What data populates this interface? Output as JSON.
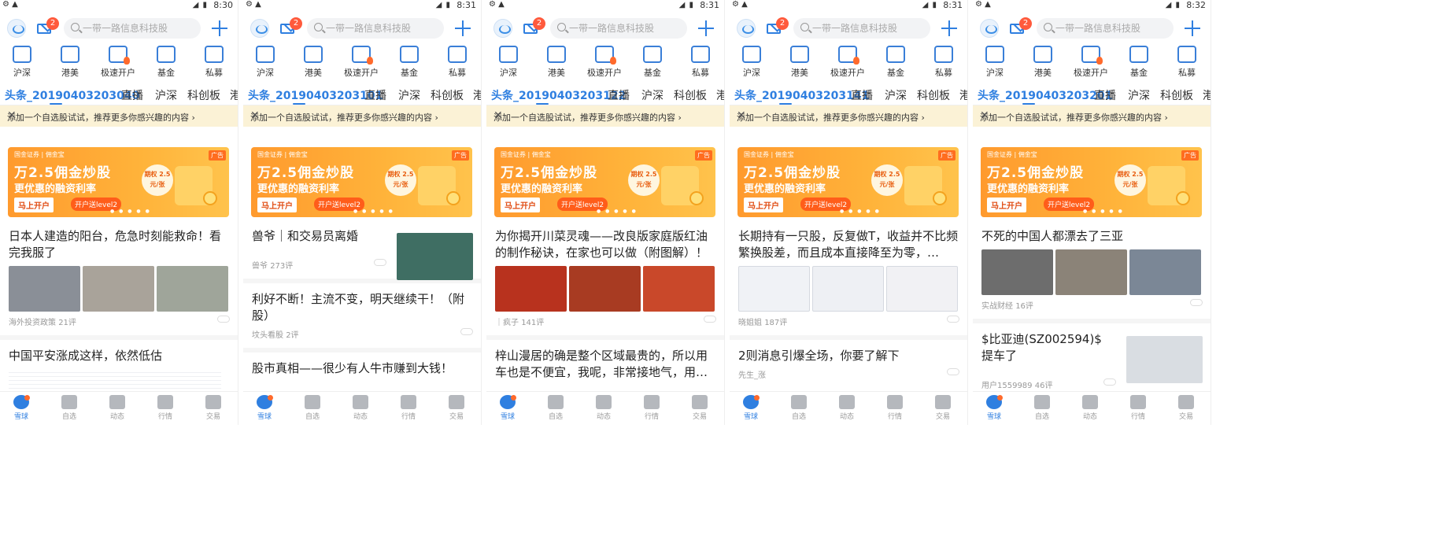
{
  "common": {
    "status_left": "⚙ ▲",
    "badge_count": "2",
    "search_placeholder": "一带一路信息科技股",
    "quick_nav": [
      "沪深",
      "港美",
      "极速开户",
      "基金",
      "私募"
    ],
    "tabs_rest": [
      "直播",
      "沪深",
      "科创板",
      "港"
    ],
    "notice": "添加一个自选股试试，推荐更多你感兴趣的内容 ›",
    "notice_close": "✕",
    "ad": {
      "brand": "国金证券 | 佣金宝",
      "tag": "广告",
      "line1": "万2.5佣金炒股",
      "line2": "更优惠的融资利率",
      "cta": "马上开户",
      "gift": "开户送level2",
      "circle": "期权 2.5元/张",
      "dots": "● ● ● ● ●"
    },
    "bottom_nav": [
      "雪球",
      "自选",
      "动态",
      "行情",
      "交易"
    ],
    "colors": {
      "accent": "#2f7fe0",
      "badge": "#ff5a3c",
      "notice_bg": "#fbf2d6",
      "ad_orange": "#ffa934"
    }
  },
  "screens": [
    {
      "time": "8:30",
      "active_tab": "头条_20190403203040",
      "articles": [
        {
          "title": "日本人建造的阳台，危急时刻能救命！看完我服了",
          "layout": "three",
          "source": "海外投资政策",
          "comments": "21评"
        },
        {
          "title": "中国平安涨成这样，依然低估",
          "layout": "table",
          "source": "",
          "comments": ""
        }
      ]
    },
    {
      "time": "8:31",
      "active_tab": "头条_20190403203101",
      "articles": [
        {
          "title": "兽爷｜和交易员离婚",
          "layout": "right",
          "source": "兽爷",
          "comments": "273评"
        },
        {
          "title": "利好不断！主流不变，明天继续干！（附股）",
          "layout": "none",
          "source": "坟头看股",
          "comments": "2评"
        },
        {
          "title": "股市真相——很少有人牛市赚到大钱！",
          "layout": "none",
          "source": "",
          "comments": ""
        }
      ]
    },
    {
      "time": "8:31",
      "active_tab": "头条_20190403203122",
      "articles": [
        {
          "title": "为你揭开川菜灵魂——改良版家庭版红油的制作秘诀，在家也可以做（附图解）！",
          "layout": "three-food",
          "source": "｜疯子",
          "comments": "141评"
        },
        {
          "title": "梓山漫居的确是整个区域最贵的，所以用车也是不便宜，我呢，非常接地气，用…",
          "layout": "none",
          "source": "",
          "comments": ""
        }
      ]
    },
    {
      "time": "8:31",
      "active_tab": "头条_20190403203141",
      "articles": [
        {
          "title": "长期持有一只股，反复做T，收益并不比频繁换股差，而且成本直接降至为零，…",
          "layout": "three-chart",
          "source": "晓姐姐",
          "comments": "187评"
        },
        {
          "title": "2则消息引爆全场，你要了解下",
          "layout": "none",
          "source": "先生_涨",
          "comments": ""
        }
      ]
    },
    {
      "time": "8:32",
      "active_tab": "头条_20190403203201",
      "articles": [
        {
          "title": "不死的中国人都漂去了三亚",
          "layout": "three-gray",
          "source": "实战财经",
          "comments": "16评"
        },
        {
          "title": "$比亚迪(SZ002594)$ 提车了",
          "layout": "right-car",
          "source": "用户1559989",
          "comments": "46评"
        }
      ]
    }
  ]
}
